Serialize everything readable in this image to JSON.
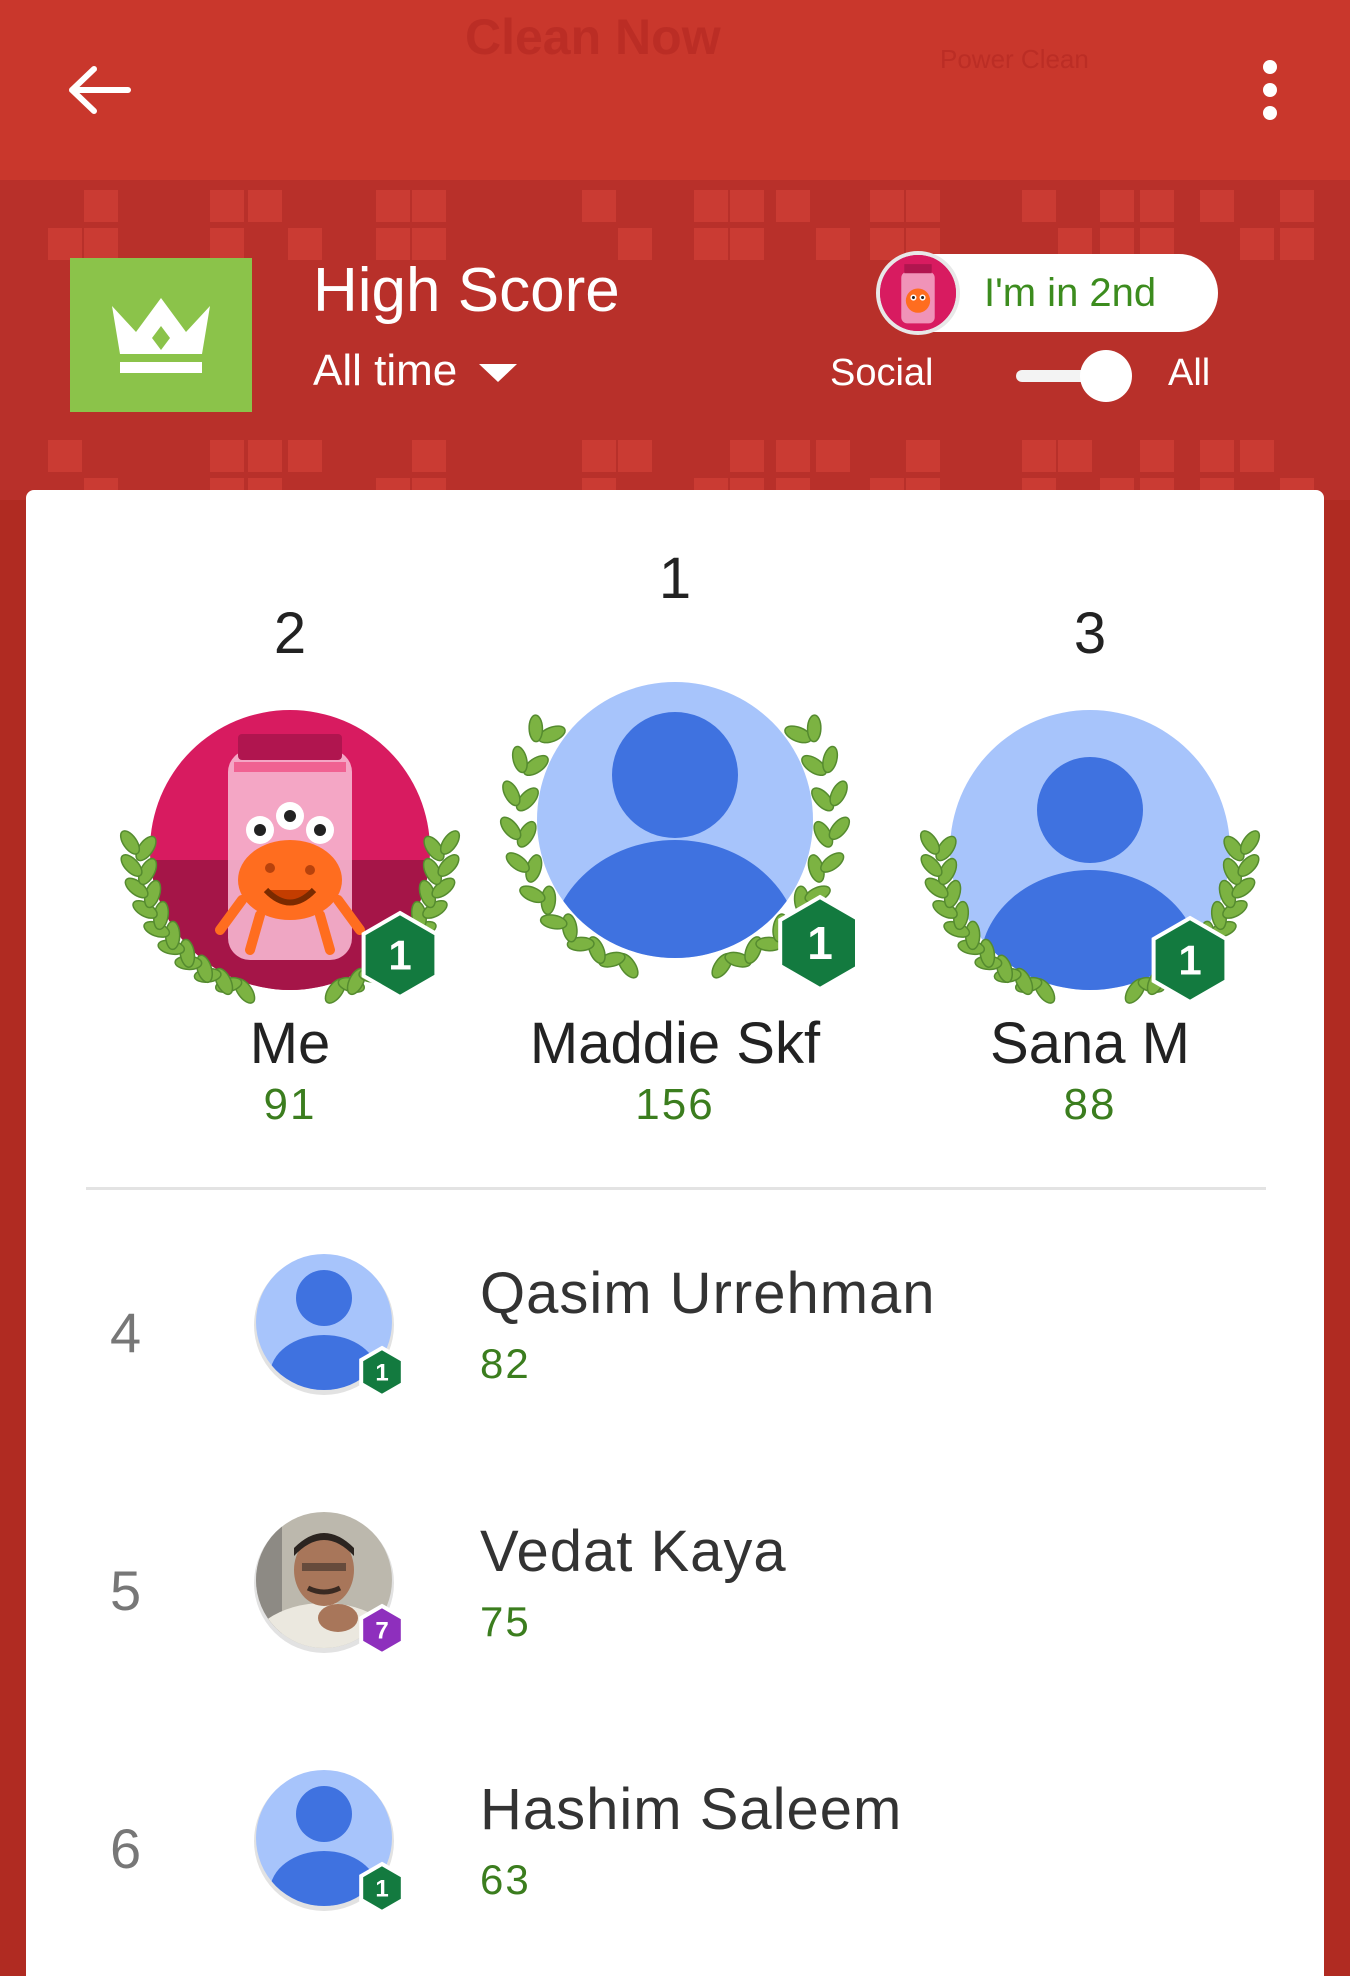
{
  "appbar": {
    "background_title": "Clean Now",
    "background_subtitle": "Power Clean"
  },
  "header": {
    "title": "High Score",
    "time_filter": "All time",
    "my_rank": "I'm in 2nd",
    "toggle_left": "Social",
    "toggle_right": "All",
    "toggle_state": "All"
  },
  "podium": [
    {
      "place": "2",
      "name": "Me",
      "score": "91",
      "level": "1",
      "avatar": "monster-jar-avatar"
    },
    {
      "place": "1",
      "name": "Maddie Skf",
      "score": "156",
      "level": "1",
      "avatar": "default-person-avatar"
    },
    {
      "place": "3",
      "name": "Sana M",
      "score": "88",
      "level": "1",
      "avatar": "default-person-avatar"
    }
  ],
  "rows": [
    {
      "rank": "4",
      "name": "Qasim Urrehman",
      "score": "82",
      "level": "1",
      "avatar": "default-person-avatar"
    },
    {
      "rank": "5",
      "name": "Vedat Kaya",
      "score": "75",
      "level": "7",
      "avatar": "photo-avatar"
    },
    {
      "rank": "6",
      "name": "Hashim Saleem",
      "score": "63",
      "level": "1",
      "avatar": "default-person-avatar"
    }
  ],
  "colors": {
    "header_red": "#b8302a",
    "crown_green": "#8bc34a",
    "score_green": "#3b7d1e",
    "level_badge_green": "#137a3f",
    "level_badge_purple": "#8e2fbd",
    "avatar_light_blue": "#a7c4fb",
    "avatar_dark_blue": "#3f72e0"
  }
}
